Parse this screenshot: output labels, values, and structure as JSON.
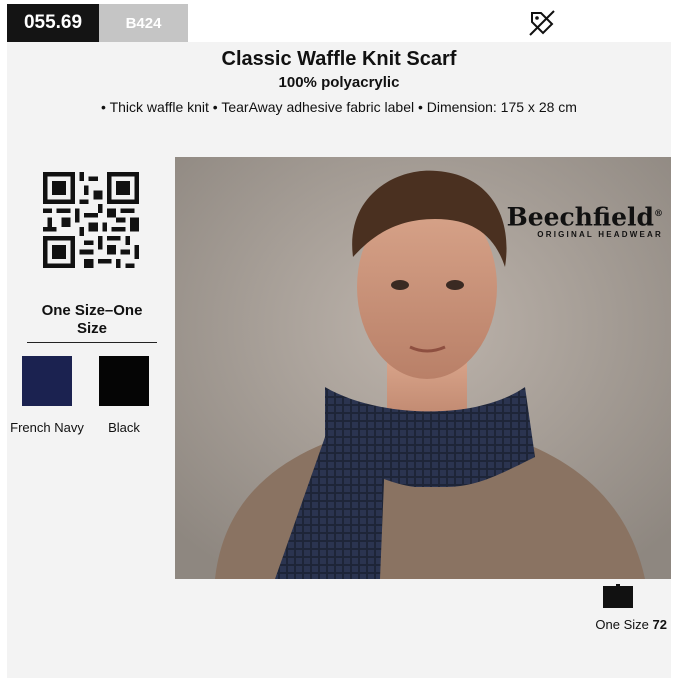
{
  "header": {
    "code": "055.69",
    "reference": "B424",
    "icon": "no-label-tag-icon"
  },
  "product": {
    "title": "Classic Waffle Knit Scarf",
    "material": "100% polyacrylic",
    "features": "• Thick waffle knit • TearAway adhesive fabric label • Dimension: 175 x 28 cm"
  },
  "sizes": {
    "title": "One Size–One Size"
  },
  "colours": [
    {
      "name": "French Navy",
      "hex": "#1b2250"
    },
    {
      "name": "Black",
      "hex": "#050505"
    }
  ],
  "brand": {
    "name": "Beechfield",
    "registered": "®",
    "tagline": "ORIGINAL HEADWEAR"
  },
  "packaging": {
    "size_label": "One Size",
    "quantity": "72",
    "icon": "carton-icon"
  },
  "image": {
    "description_icon": "model-wearing-scarf-photo"
  }
}
